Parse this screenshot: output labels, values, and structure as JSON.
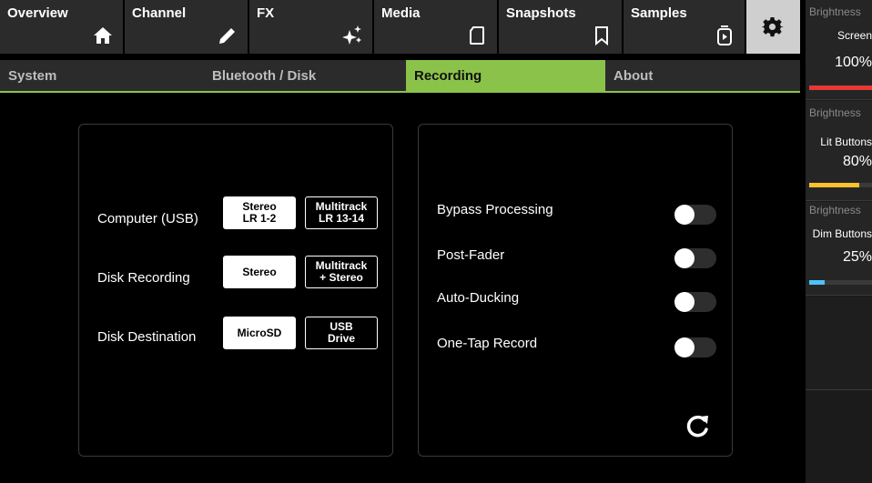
{
  "top_tabs": [
    {
      "label": "Overview",
      "icon": "home-icon"
    },
    {
      "label": "Channel",
      "icon": "pencil-icon"
    },
    {
      "label": "FX",
      "icon": "sparkle-icon"
    },
    {
      "label": "Media",
      "icon": "sd-card-icon"
    },
    {
      "label": "Snapshots",
      "icon": "bookmark-icon"
    },
    {
      "label": "Samples",
      "icon": "sampler-icon"
    }
  ],
  "settings_tab": {
    "icon": "gear-icon",
    "active": true
  },
  "sub_tabs": [
    {
      "label": "System",
      "active": false
    },
    {
      "label": "Bluetooth / Disk",
      "active": false
    },
    {
      "label": "Recording",
      "active": true
    },
    {
      "label": "About",
      "active": false
    }
  ],
  "recording": {
    "rows": [
      {
        "label": "Computer (USB)",
        "options": [
          {
            "line1": "Stereo",
            "line2": "LR 1-2",
            "selected": true
          },
          {
            "line1": "Multitrack",
            "line2": "LR 13-14",
            "selected": false
          }
        ]
      },
      {
        "label": "Disk Recording",
        "options": [
          {
            "line1": "Stereo",
            "line2": "",
            "selected": true
          },
          {
            "line1": "Multitrack",
            "line2": "+ Stereo",
            "selected": false
          }
        ]
      },
      {
        "label": "Disk Destination",
        "options": [
          {
            "line1": "MicroSD",
            "line2": "",
            "selected": true
          },
          {
            "line1": "USB",
            "line2": "Drive",
            "selected": false
          }
        ]
      }
    ],
    "toggles": [
      {
        "label": "Bypass Processing",
        "on": false
      },
      {
        "label": "Post-Fader",
        "on": false
      },
      {
        "label": "Auto-Ducking",
        "on": false
      },
      {
        "label": "One-Tap Record",
        "on": false
      }
    ],
    "reset_icon": "refresh-icon"
  },
  "brightness": [
    {
      "title": "Brightness",
      "name": "Screen",
      "value": "100%",
      "level": 1.0,
      "color": "#e53935"
    },
    {
      "title": "Brightness",
      "name": "Lit Buttons",
      "value": "80%",
      "level": 0.8,
      "color": "#fbc02d"
    },
    {
      "title": "Brightness",
      "name": "Dim Buttons",
      "value": "25%",
      "level": 0.25,
      "color": "#4fc3f7"
    }
  ]
}
